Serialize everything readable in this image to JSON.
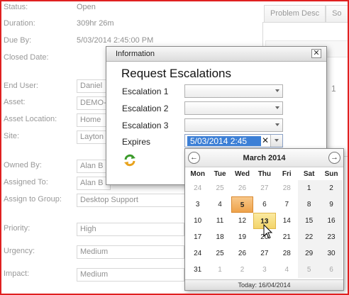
{
  "form": {
    "status": {
      "label": "Status:",
      "value": "Open"
    },
    "duration": {
      "label": "Duration:",
      "value": "309hr 26m"
    },
    "due_by": {
      "label": "Due By:",
      "value": "5/03/2014 2:45:00 PM"
    },
    "closed_date": {
      "label": "Closed Date:"
    },
    "end_user": {
      "label": "End User:",
      "value": "Daniel"
    },
    "asset": {
      "label": "Asset:",
      "value": "DEMO-"
    },
    "asset_location": {
      "label": "Asset Location:",
      "value": "Home"
    },
    "site": {
      "label": "Site:",
      "value": "Layton"
    },
    "owned_by": {
      "label": "Owned By:",
      "value": "Alan B"
    },
    "assigned_to": {
      "label": "Assigned To:",
      "value": "Alan B"
    },
    "assign_to_group": {
      "label": "Assign to Group:",
      "value": "Desktop Support"
    },
    "priority": {
      "label": "Priority:",
      "value": "High"
    },
    "urgency": {
      "label": "Urgency:",
      "value": "Medium"
    },
    "impact": {
      "label": "Impact:",
      "value": "Medium"
    }
  },
  "tabs": [
    {
      "label": "Problem Desc"
    },
    {
      "label": "So"
    }
  ],
  "editor": {
    "line_number": "1"
  },
  "dialog": {
    "title": "Information",
    "close_glyph": "✕",
    "heading": "Request Escalations",
    "escalation_1": "Escalation 1",
    "escalation_2": "Escalation 2",
    "escalation_3": "Escalation 3",
    "expires_label": "Expires",
    "expires_value": "5/03/2014   2:45",
    "clear_glyph": "✕"
  },
  "calendar": {
    "title": "March 2014",
    "prev_glyph": "←",
    "next_glyph": "→",
    "dows": [
      "Mon",
      "Tue",
      "Wed",
      "Thu",
      "Fri",
      "Sat",
      "Sun"
    ],
    "weeks": [
      [
        "24",
        "25",
        "26",
        "27",
        "28",
        "1",
        "2"
      ],
      [
        "3",
        "4",
        "5",
        "6",
        "7",
        "8",
        "9"
      ],
      [
        "10",
        "11",
        "12",
        "13",
        "14",
        "15",
        "16"
      ],
      [
        "17",
        "18",
        "19",
        "20",
        "21",
        "22",
        "23"
      ],
      [
        "24",
        "25",
        "26",
        "27",
        "28",
        "29",
        "30"
      ],
      [
        "31",
        "1",
        "2",
        "3",
        "4",
        "5",
        "6"
      ]
    ],
    "selected_day": "5",
    "today_day": "13",
    "footer": "Today: 16/04/2014"
  },
  "colors": {
    "frame": "#e02020",
    "selection": "#3c7fd6",
    "selected_day": "#eea24a",
    "today_day": "#f3d46a"
  }
}
